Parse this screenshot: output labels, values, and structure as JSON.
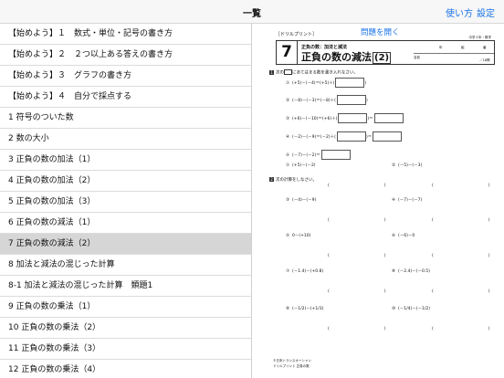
{
  "nav": {
    "title": "一覧",
    "help": "使い方",
    "settings": "設定"
  },
  "list": {
    "selected_index": 10,
    "items": [
      "【始めよう】１　数式・単位・記号の書き方",
      "【始めよう】２　２つ以上ある答えの書き方",
      "【始めよう】３　グラフの書き方",
      "【始めよう】４　自分で採点する",
      "1 符号のついた数",
      "2 数の大小",
      "3 正負の数の加法（1）",
      "4 正負の数の加法（2）",
      "5 正負の数の加法（3）",
      "6 正負の数の減法（1）",
      "7 正負の数の減法（2）",
      "8 加法と減法の混じった計算",
      "8-1 加法と減法の混じった計算　類題1",
      "9 正負の数の乗法（1）",
      "10 正負の数の乗法（2）",
      "11 正負の数の乗法（3）",
      "12 正負の数の乗法（4）"
    ]
  },
  "doc": {
    "open_link": "問題を開く",
    "tag": "［ドリルプリント］",
    "corner": "中学１年・数学",
    "number": "7",
    "subtitle": "正負の数：加法と減法",
    "main_title": "正負の数の減法",
    "main_title_suffix": "(2)",
    "year": "年",
    "class": "組",
    "seat": "番",
    "name": "名前",
    "score": "／18問",
    "q1": {
      "mark": "1",
      "prefix": "次の",
      "title": "にあてはまる数を書き入れなさい。",
      "problems": [
        {
          "label": "①",
          "expr": "(+5)－(－4)＝(+5)＋(",
          "tail": ")"
        },
        {
          "label": "②",
          "expr": "(－8)－(－3)＝(－8)＋(",
          "tail": ")"
        },
        {
          "label": "③",
          "expr": "(+6)－(－10)＝(+6)＋(",
          "tail": ")＝"
        },
        {
          "label": "④",
          "expr": "(－2)－(－9)＝(－2)＋(",
          "tail": ")＝"
        },
        {
          "label": "⑤",
          "expr": "(－7)－(－2)＝",
          "tail": ""
        }
      ]
    },
    "q2": {
      "mark": "2",
      "title": "次の計算をしなさい。",
      "problems": [
        {
          "label": "①",
          "expr": "(+5)－(－2)"
        },
        {
          "label": "②",
          "expr": "(－5)－(－3)"
        },
        {
          "label": "③",
          "expr": "(－4)－(－9)"
        },
        {
          "label": "④",
          "expr": "(－7)－(－7)"
        },
        {
          "label": "⑤",
          "expr": "0－(+10)"
        },
        {
          "label": "⑥",
          "expr": "(－6)－0"
        },
        {
          "label": "⑦",
          "expr": "(－1.4)－(+0.8)"
        },
        {
          "label": "⑧",
          "expr": "(－2.4)－(－0.5)"
        },
        {
          "label": "⑨",
          "expr": "(－1/2)－(+1/3)"
        },
        {
          "label": "⑩",
          "expr": "(－1/4)－(－1/2)"
        }
      ]
    },
    "footer_1": "©日本トランスオーシャン",
    "footer_2": "ドリルプリント 正負の数"
  }
}
